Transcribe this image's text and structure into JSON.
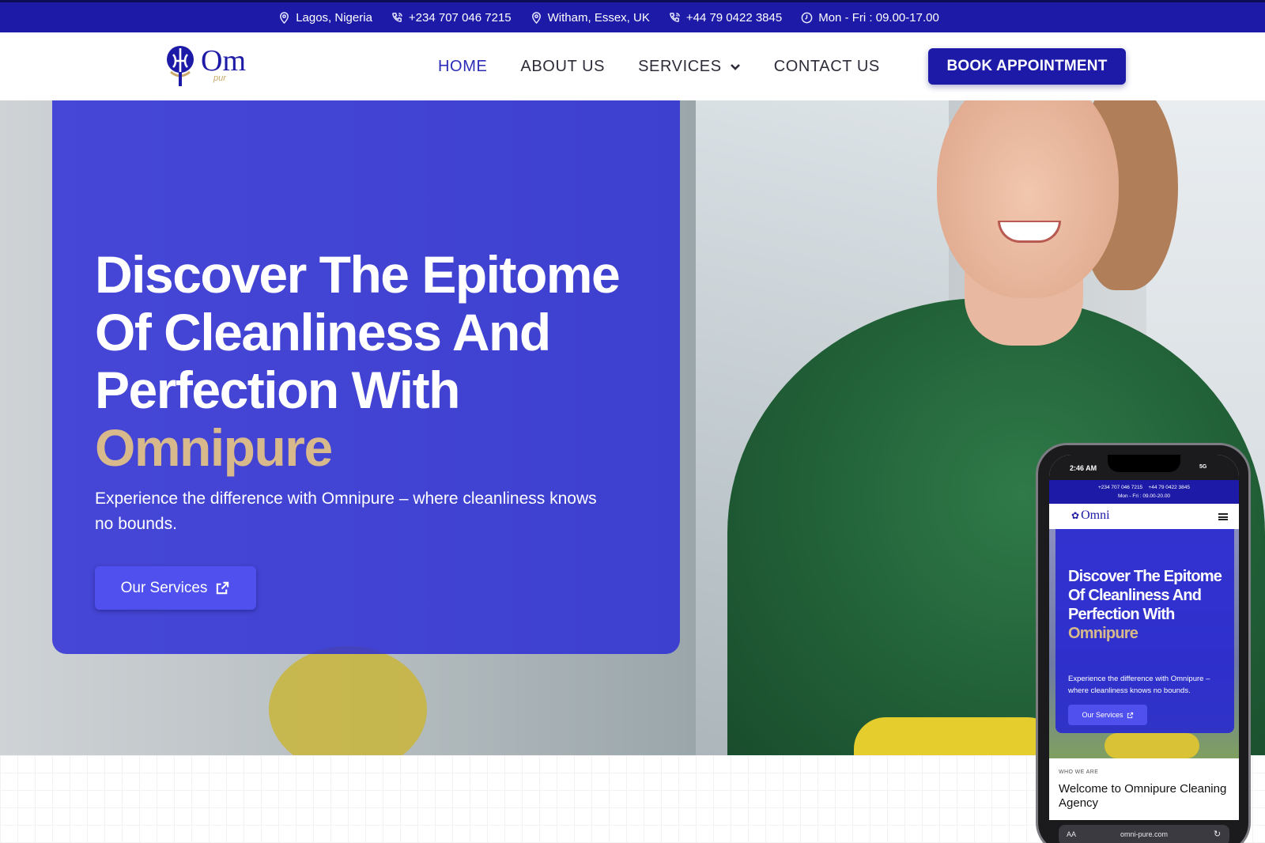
{
  "topbar": {
    "items": [
      {
        "icon": "location-pin-icon",
        "text": "Lagos, Nigeria"
      },
      {
        "icon": "phone-icon",
        "text": "+234 707 046 7215"
      },
      {
        "icon": "location-pin-icon",
        "text": "Witham, Essex, UK"
      },
      {
        "icon": "phone-icon",
        "text": "+44 79 0422 3845"
      },
      {
        "icon": "clock-icon",
        "text": "Mon - Fri : 09.00-17.00"
      }
    ]
  },
  "header": {
    "logo_text": "Om",
    "logo_sub": "pur",
    "nav": [
      {
        "label": "HOME",
        "active": true
      },
      {
        "label": "ABOUT US"
      },
      {
        "label": "SERVICES"
      },
      {
        "label": "CONTACT US"
      }
    ],
    "book_label": "BOOK APPOINTMENT"
  },
  "hero": {
    "title_line": "Discover The Epitome Of Cleanliness And Perfection With",
    "title_accent": "Omnipure",
    "subtitle": "Experience the difference with Omnipure – where cleanliness knows no bounds.",
    "button_label": "Our Services"
  },
  "phone": {
    "time": "2:46 AM",
    "network": "5G",
    "top_phone_1": "+234 707 046 7215",
    "top_phone_2": "+44 79 0422 3845",
    "top_hours": "Mon - Fri : 09.00-20.00",
    "logo_text": "Omni",
    "title_line": "Discover The Epitome Of Cleanliness And Perfection With",
    "title_accent": "Omnipure",
    "subtitle": "Experience the difference with Omnipure – where cleanliness knows no bounds.",
    "button_label": "Our Services",
    "section_label": "WHO WE ARE",
    "section_title": "Welcome to Omnipure Cleaning Agency",
    "url_aa": "AA",
    "url": "omni-pure.com"
  },
  "colors": {
    "brand_blue": "#1c1aa6",
    "accent_gold": "#d7b98b",
    "button_blue": "#5050ee"
  }
}
